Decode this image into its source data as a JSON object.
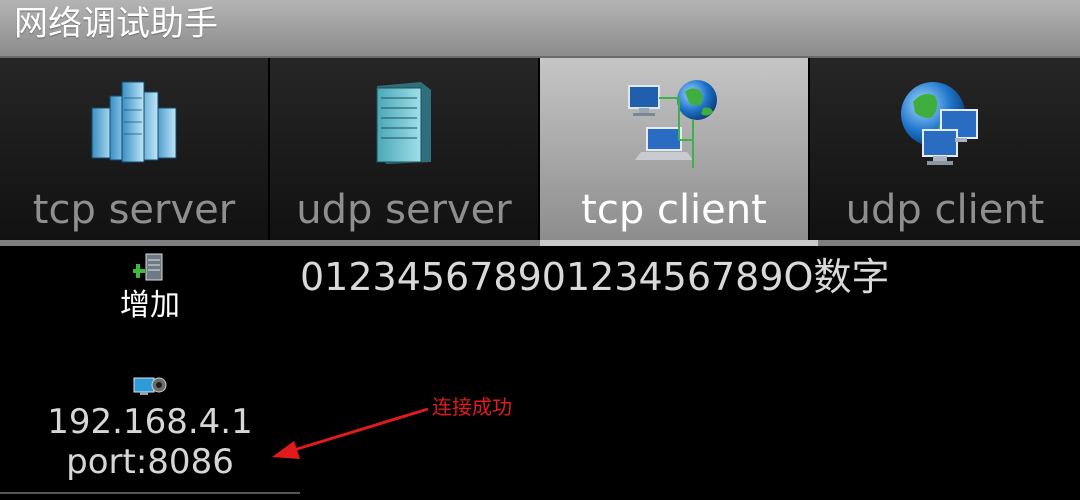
{
  "app": {
    "title": "网络调试助手"
  },
  "tabs": [
    {
      "label": "tcp server",
      "icon": "server-cluster-icon",
      "active": false
    },
    {
      "label": "udp server",
      "icon": "server-tower-icon",
      "active": false
    },
    {
      "label": "tcp client",
      "icon": "network-computers-globe-icon",
      "active": true
    },
    {
      "label": "udp client",
      "icon": "globe-monitors-icon",
      "active": false
    }
  ],
  "sidebar": {
    "add": {
      "label": "增加",
      "icon": "add-server-icon"
    },
    "connection": {
      "ip": "192.168.4.1",
      "port": "port:8086",
      "icon": "connected-device-icon"
    }
  },
  "main": {
    "data_text": "01234567890123456789O数字"
  },
  "annotation": {
    "text": "连接成功",
    "color": "#e11b1b"
  },
  "colors": {
    "active_tab": "#c6c6c6",
    "inactive_tab": "#1a1a1a",
    "background": "#000000"
  }
}
